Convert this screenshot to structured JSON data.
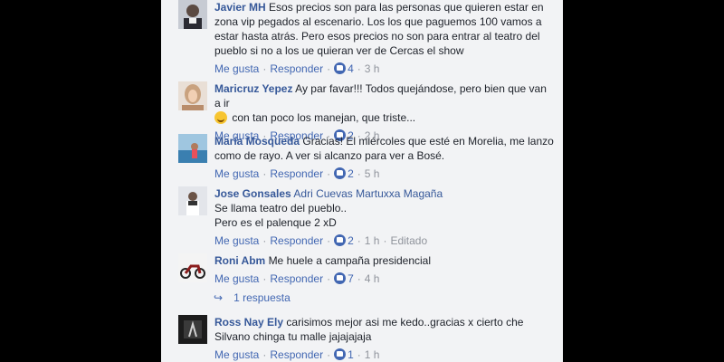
{
  "labels": {
    "like": "Me gusta",
    "reply": "Responder",
    "edited": "Editado",
    "sep": "·"
  },
  "comments": [
    {
      "author": "Javier MH",
      "text": "Esos precios son para las personas que quieren estar en zona vip pegados al escenario. Los los que paguemos 100 vamos a estar hasta atrás. Pero esos precios no son para entrar al teatro del pueblo si no a los ue quieran ver de Cercas el show",
      "reactions": "4",
      "time": "3 h"
    },
    {
      "author": "Maricruz Yepez",
      "text": "Ay par favar!!! Todos quejándose, pero bien que van a ir",
      "text2": "con tan poco los manejan, que triste...",
      "reactions": "2",
      "time": "2 h"
    },
    {
      "author": "María Mosqueda",
      "text": "Gracias! El miércoles que esté en Morelia, me lanzo como de rayo. A ver si alcanzo para ver a Bosé.",
      "reactions": "2",
      "time": "5 h"
    },
    {
      "author": "Jose Gonsales",
      "tagged": "Adri Cuevas Martuxxa Magaña",
      "line2": "Se llama teatro del pueblo..",
      "line3": "Pero es el palenque 2 xD",
      "reactions": "2",
      "time": "1 h"
    },
    {
      "author": "Roni Abm",
      "text": "Me huele a campaña presidencial",
      "reactions": "7",
      "time": "4 h",
      "replies_label": "1 respuesta"
    },
    {
      "author": "Ross Nay Ely",
      "text": "carisimos mejor asi me kedo..gracias x cierto che Silvano chinga tu malle jajajajaja",
      "reactions": "1",
      "time": "1 h"
    }
  ],
  "colors": {
    "link": "#365899",
    "action": "#4267b2",
    "muted": "#90949c",
    "panel": "#f2f3f5"
  }
}
